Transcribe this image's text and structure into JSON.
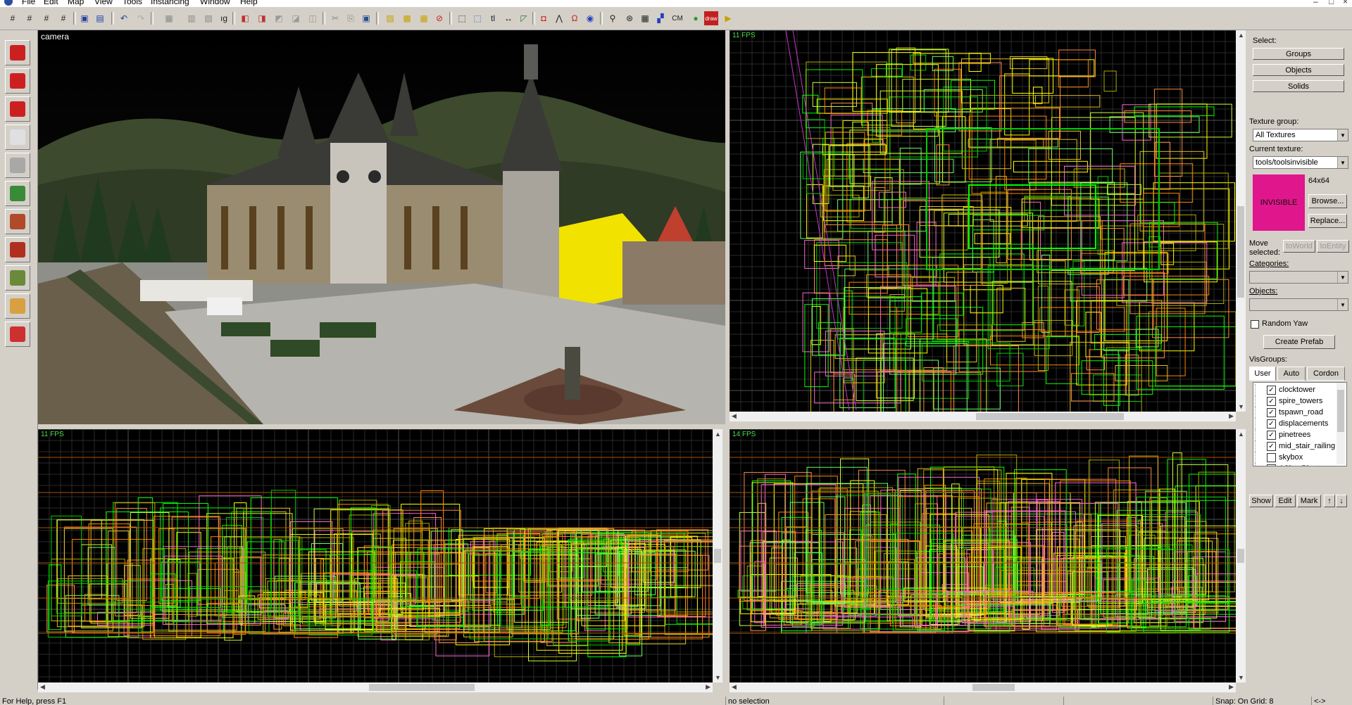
{
  "menu": {
    "items": [
      "File",
      "Edit",
      "Map",
      "View",
      "Tools",
      "Instancing",
      "Window",
      "Help"
    ],
    "window_controls": [
      "–",
      "□",
      "×"
    ]
  },
  "toolbar": {
    "text_buttons": {
      "cm": "CM",
      "draw": "draw"
    },
    "icons": [
      "grid-icon",
      "grid-smaller-icon",
      "grid-larger-icon",
      "grid-toggle-icon",
      "group-icon",
      "ungroup-icon",
      "undo-icon",
      "redo-icon",
      "carve-icon",
      "hollow-icon",
      "clip-icon",
      "vertex-icon",
      "texture-lock-icon",
      "cut-icon",
      "copy-icon",
      "paste-icon",
      "hide-icon",
      "show-icon",
      "cordon-icon",
      "selection-tool-icon",
      "magnify-icon",
      "transform-icon",
      "run-map-icon"
    ]
  },
  "palette": {
    "tools": [
      {
        "name": "selection-tool-icon",
        "color": "#cc2020"
      },
      {
        "name": "magnify-tool-icon",
        "color": "#cc2020"
      },
      {
        "name": "camera-tool-icon",
        "color": "#cc2020"
      },
      {
        "name": "entity-tool-icon",
        "color": "#e0e0e0"
      },
      {
        "name": "block-tool-icon",
        "color": "#a8a8a8"
      },
      {
        "name": "texture-application-icon",
        "color": "#3a8a3a"
      },
      {
        "name": "apply-texture-icon",
        "color": "#b04a2a"
      },
      {
        "name": "decal-tool-icon",
        "color": "#b03020"
      },
      {
        "name": "overlay-tool-icon",
        "color": "#6a8a3a"
      },
      {
        "name": "clipping-tool-icon",
        "color": "#d8a040"
      },
      {
        "name": "vertex-tool-icon",
        "color": "#cc3030"
      }
    ]
  },
  "viewports": {
    "camera": {
      "label": "camera"
    },
    "top": {
      "label": "11 FPS"
    },
    "front": {
      "label": "11 FPS"
    },
    "side": {
      "label": "14 FPS"
    }
  },
  "right_panel": {
    "select_label": "Select:",
    "select_buttons": [
      "Groups",
      "Objects",
      "Solids"
    ],
    "texture_group_label": "Texture group:",
    "texture_group_value": "All Textures",
    "current_texture_label": "Current texture:",
    "current_texture_value": "tools/toolsinvisible",
    "texture_size": "64x64",
    "texture_preview_text": "INVISIBLE",
    "texture_preview_color": "#e0168c",
    "browse_label": "Browse...",
    "replace_label": "Replace...",
    "move_selected_label_1": "Move",
    "move_selected_label_2": "selected:",
    "to_world_label": "toWorld",
    "to_entity_label": "toEntity",
    "categories_label": "Categories:",
    "objects_label": "Objects:",
    "random_yaw_label": "Random Yaw",
    "create_prefab_label": "Create Prefab",
    "visgroups_label": "VisGroups:",
    "visgroup_tabs": [
      "User",
      "Auto",
      "Cordon"
    ],
    "visgroups": [
      {
        "name": "clocktower",
        "checked": true
      },
      {
        "name": "spire_towers",
        "checked": true
      },
      {
        "name": "tspawn_road",
        "checked": true
      },
      {
        "name": "displacements",
        "checked": true
      },
      {
        "name": "pinetrees",
        "checked": true
      },
      {
        "name": "mid_stair_railing",
        "checked": true
      },
      {
        "name": "skybox",
        "checked": false
      },
      {
        "name": "ASite_Plants",
        "checked": true
      }
    ],
    "bottom_buttons": [
      "Show",
      "Edit",
      "Mark",
      "↑",
      "↓"
    ]
  },
  "status": {
    "help": "For Help, press F1",
    "selection": "no selection",
    "snap": "Snap: On Grid: 8",
    "extra": "<->"
  }
}
